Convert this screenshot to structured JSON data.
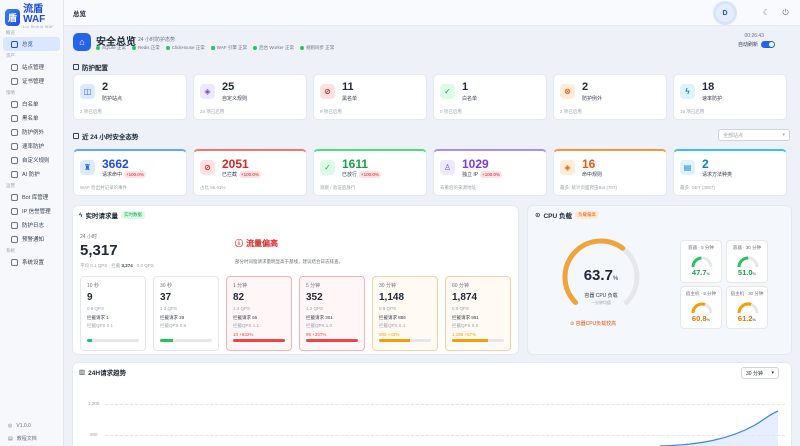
{
  "app": {
    "name": "流盾 WAF",
    "sub": "Liu Shield WAF",
    "breadcrumb": "总览"
  },
  "sidebar": {
    "sections": [
      {
        "title": "概览",
        "items": [
          "总览"
        ]
      },
      {
        "title": "资产",
        "items": [
          "站点管理",
          "证书管理"
        ]
      },
      {
        "title": "策略",
        "items": [
          "白名单",
          "黑名单",
          "防护例外",
          "速率防护",
          "自定义规则",
          "AI 防护"
        ]
      },
      {
        "title": "运营",
        "items": [
          "Bot 库管理",
          "IP 信誉管理",
          "防护日志",
          "预警通知"
        ]
      },
      {
        "title": "系统",
        "items": [
          "系统设置"
        ]
      }
    ],
    "version": "V1.0.0",
    "docs": "教程文档"
  },
  "header": {
    "title": "安全总览",
    "subtitle": "24 小时防护态势",
    "time": "00:26:43",
    "auto_refresh": "自动刷新",
    "statuses": [
      "SQLite 正常",
      "Redis 正常",
      "ClickHouse 正常",
      "WAF 引擎 正常",
      "后台 Worker 正常",
      "规则同步 正常"
    ]
  },
  "config": {
    "title": "防护配置",
    "cards": [
      {
        "icon": "site-icon",
        "value": "2",
        "label": "防护站点",
        "sub": "2 项已启用"
      },
      {
        "icon": "shield-icon",
        "value": "25",
        "label": "自定义规则",
        "sub": "24 项已启用"
      },
      {
        "icon": "ban-icon",
        "value": "11",
        "label": "黑名单",
        "sub": "9 项已启用"
      },
      {
        "icon": "check-icon",
        "value": "1",
        "label": "白名单",
        "sub": "0 项已启用"
      },
      {
        "icon": "exception-icon",
        "value": "2",
        "label": "防护例外",
        "sub": "2 项已启用"
      },
      {
        "icon": "rate-icon",
        "value": "18",
        "label": "速率防护",
        "sub": "16 项已启用"
      }
    ]
  },
  "posture": {
    "title": "近 24 小时安全态势",
    "filter": "全部站点",
    "cards": [
      {
        "value": "3662",
        "label": "请求命中",
        "badge": "+100.0%",
        "sub": "WAF 检出并记录的事件"
      },
      {
        "value": "2051",
        "label": "已拦截",
        "badge": "+100.0%",
        "sub": "占比 56.01%"
      },
      {
        "value": "1611",
        "label": "已放行",
        "badge": "+100.0%",
        "sub": "观察 / 验证后放行"
      },
      {
        "value": "1029",
        "label": "独立 IP",
        "badge": "+100.0%",
        "sub": "去重后的来源地址"
      },
      {
        "value": "16",
        "label": "命中规则",
        "badge": "",
        "sub": "最多: 统计页面爬虫Bot (707)"
      },
      {
        "value": "2",
        "label": "请求方法种类",
        "badge": "",
        "sub": "最多: GET (3557)"
      }
    ]
  },
  "realtime": {
    "title": "实时请求量",
    "live": "实时数据",
    "window": "24 小时",
    "total": "5,317",
    "avg": "平均 0.1 QPS",
    "blocked_prefix": "拦截",
    "blocked": "3,274",
    "blocked_qps": "0.0 QPS",
    "alert_title": "流量偏高",
    "alert_text": "部分时间窗请求量明显高于基线，建议结合日志排查。",
    "windows": [
      {
        "t": "10 秒",
        "v": "9",
        "q": "0.9 QPS",
        "a": "拦截请求 1",
        "b": "拦截QPS 0.1",
        "pct": 0.1,
        "color": "#22c55e",
        "state": "normal",
        "delta": ""
      },
      {
        "t": "30 秒",
        "v": "37",
        "q": "1.2 QPS",
        "a": "拦截请求 28",
        "b": "拦截QPS 0.9",
        "pct": 0.25,
        "color": "#22c55e",
        "state": "normal",
        "delta": ""
      },
      {
        "t": "1 分钟",
        "v": "82",
        "q": "1.4 QPS",
        "a": "拦截请求 65",
        "b": "拦截QPS 1.1",
        "pct": 1.0,
        "color": "#ef4444",
        "state": "hot",
        "delta": "10 +632%"
      },
      {
        "t": "5 分钟",
        "v": "352",
        "q": "1.2 QPS",
        "a": "拦截请求 301",
        "b": "拦截QPS 1.0",
        "pct": 1.0,
        "color": "#ef4444",
        "state": "hot",
        "delta": "96 +267%"
      },
      {
        "t": "30 分钟",
        "v": "1,148",
        "q": "0.6 QPS",
        "a": "拦截请求 886",
        "b": "拦截QPS 0.4",
        "pct": 0.6,
        "color": "#f59e0b",
        "state": "warm",
        "delta": "600 +43%"
      },
      {
        "t": "60 分钟",
        "v": "1,874",
        "q": "0.5 QPS",
        "a": "拦截请求 951",
        "b": "拦截QPS 0.3",
        "pct": 0.7,
        "color": "#f59e0b",
        "state": "warm",
        "delta": "1,195 +57%"
      }
    ]
  },
  "cpu": {
    "title": "CPU 负载",
    "badge": "负载偏高",
    "value": "63.7",
    "unit": "%",
    "label": "容器 CPU 负载",
    "sub": "一分钟均值",
    "warning": "容器CPU负载较高",
    "gauges": [
      {
        "t": "容器 · 5 分钟",
        "v": "47.7",
        "pct": 0.477,
        "color": "#22c55e"
      },
      {
        "t": "容器 · 30 分钟",
        "v": "51.0",
        "pct": 0.51,
        "color": "#22c55e"
      },
      {
        "t": "宿主机 · 5 分钟",
        "v": "60.8",
        "pct": 0.608,
        "color": "#f59e0b"
      },
      {
        "t": "宿主机 · 30 分钟",
        "v": "61.2",
        "pct": 0.612,
        "color": "#f59e0b"
      }
    ]
  },
  "trend": {
    "title": "24H请求趋势",
    "range": "30 分钟"
  },
  "chart_data": {
    "type": "area",
    "title": "24H请求趋势",
    "y_ticks": [
      "1,200",
      "900"
    ]
  }
}
